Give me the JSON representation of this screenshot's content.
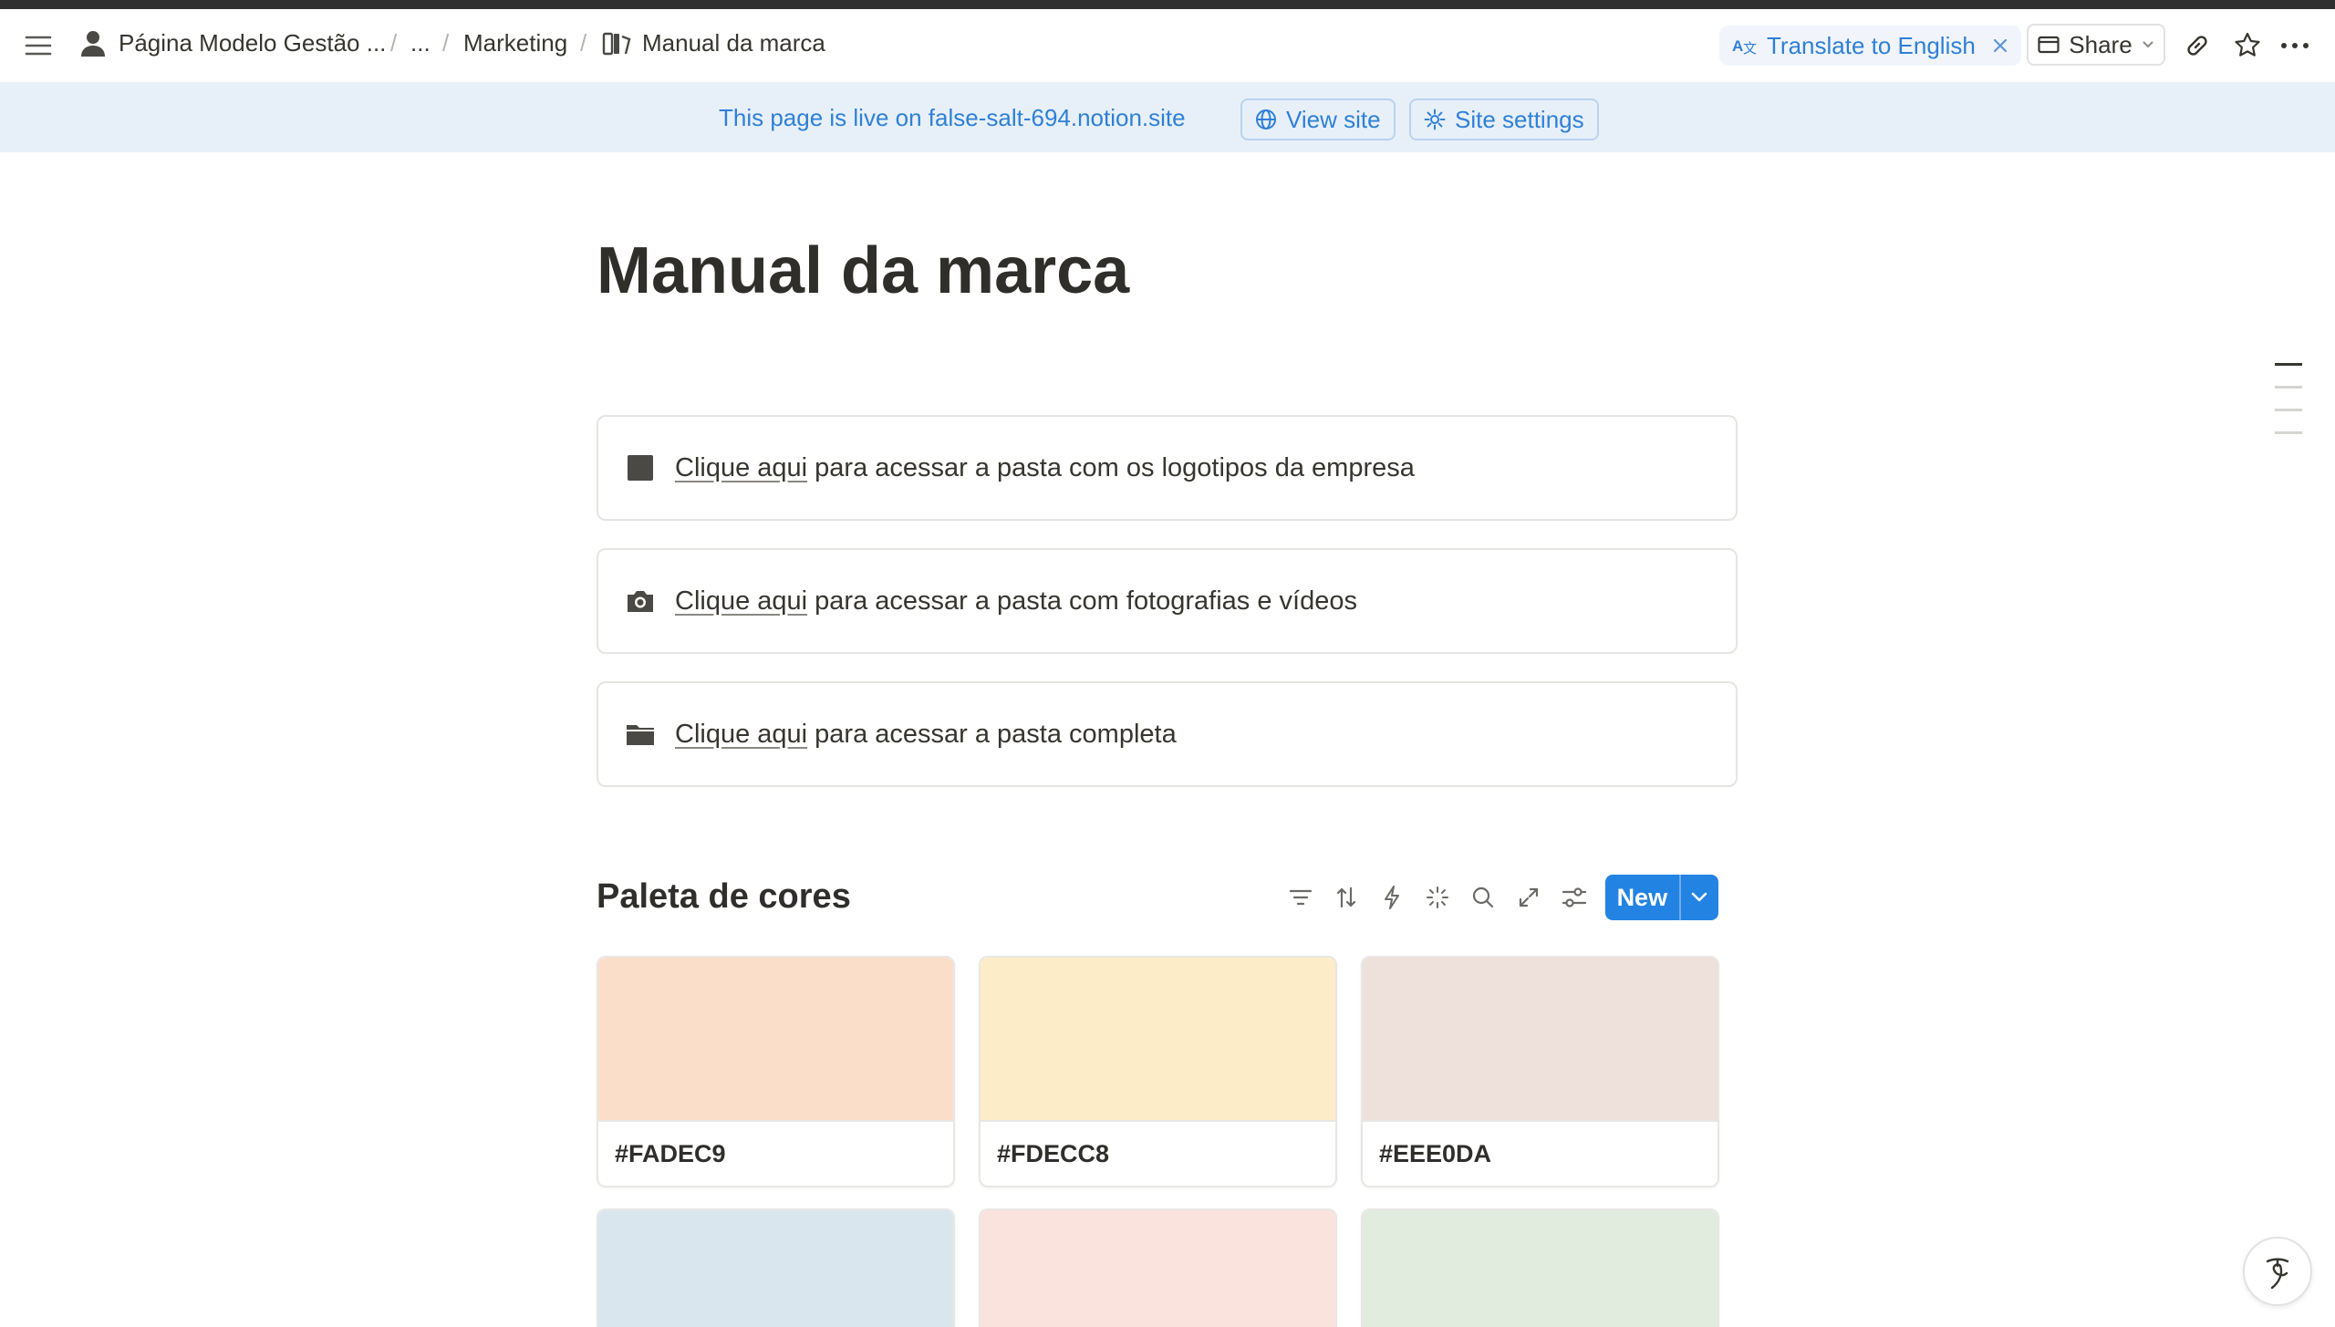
{
  "breadcrumb": {
    "workspace": "Página Modelo Gestão ...",
    "ellipsis": "...",
    "section": "Marketing",
    "page": "Manual da marca"
  },
  "topbar": {
    "translate_label": "Translate to English",
    "share_label": "Share"
  },
  "banner": {
    "message": "This page is live on false-salt-694.notion.site",
    "view_site": "View site",
    "site_settings": "Site settings"
  },
  "page": {
    "title": "Manual da marca"
  },
  "callouts": [
    {
      "icon": "square-icon",
      "link": "Clique aqui",
      "text": " para acessar a pasta com os logotipos da empresa"
    },
    {
      "icon": "camera-icon",
      "link": "Clique aqui",
      "text": " para acessar a pasta com fotografias e vídeos"
    },
    {
      "icon": "folder-icon",
      "link": "Clique aqui",
      "text": " para acessar a pasta completa"
    }
  ],
  "database": {
    "title": "Paleta de cores",
    "new_label": "New",
    "cards": [
      {
        "label": "#FADEC9",
        "color": "#FADEC9"
      },
      {
        "label": "#FDECC8",
        "color": "#FDECC8"
      },
      {
        "label": "#EEE0DA",
        "color": "#EEE0DA"
      },
      {
        "label": "",
        "color": "#D9E6EE"
      },
      {
        "label": "",
        "color": "#FAE2DD"
      },
      {
        "label": "",
        "color": "#E1ECDF"
      }
    ]
  },
  "colors": {
    "accent": "#2383E2",
    "banner_bg": "#E7F0F9",
    "banner_text": "#2F80D6"
  }
}
